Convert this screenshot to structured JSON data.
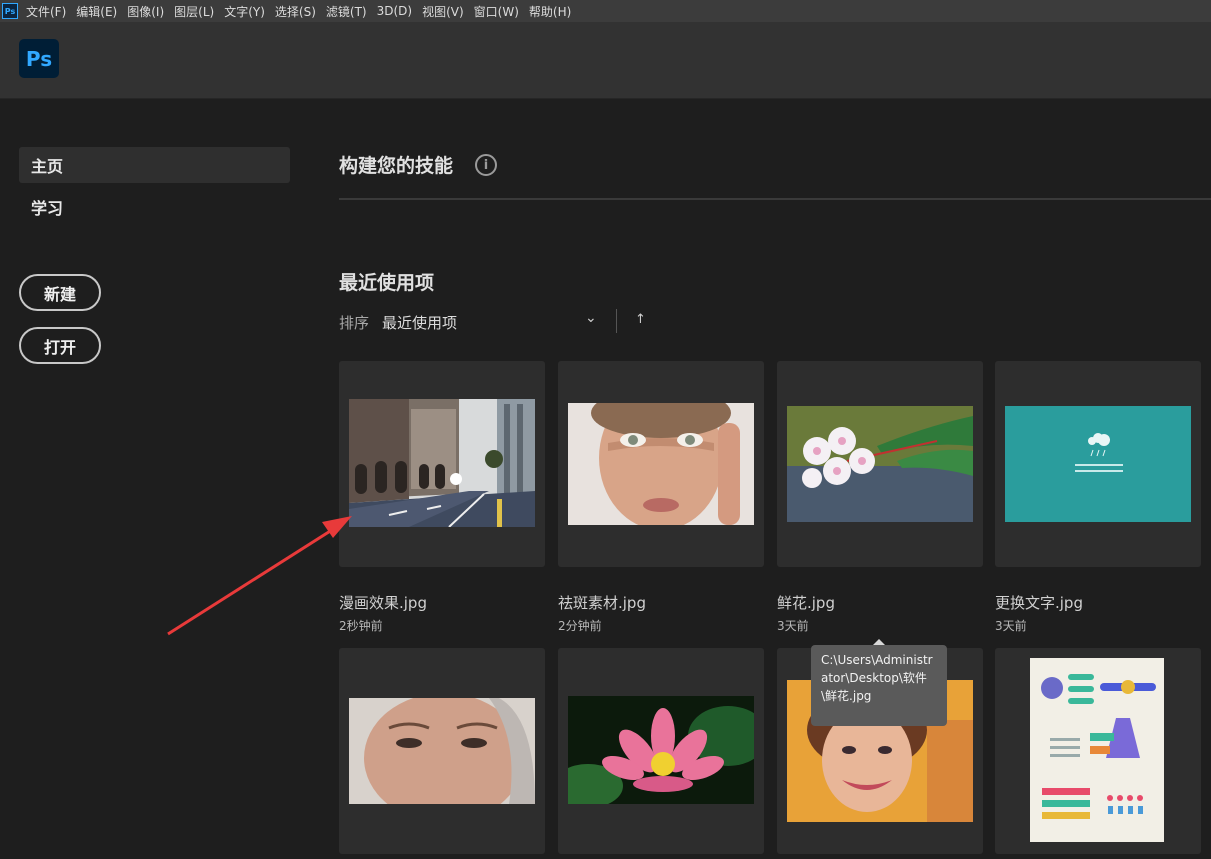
{
  "menubar": {
    "items": [
      "文件(F)",
      "编辑(E)",
      "图像(I)",
      "图层(L)",
      "文字(Y)",
      "选择(S)",
      "滤镜(T)",
      "3D(D)",
      "视图(V)",
      "窗口(W)",
      "帮助(H)"
    ]
  },
  "app": {
    "logo_text": "Ps",
    "accent": "#31a8ff"
  },
  "sidebar": {
    "items": [
      {
        "label": "主页",
        "active": true
      },
      {
        "label": "学习",
        "active": false
      }
    ],
    "new_button": "新建",
    "open_button": "打开"
  },
  "main": {
    "skills_title": "构建您的技能",
    "info_icon": "i",
    "recent_title": "最近使用项",
    "sort_label": "排序",
    "sort_value": "最近使用项",
    "sort_chevron": "⌄",
    "sort_direction_icon": "↑"
  },
  "files": [
    {
      "name": "漫画效果.jpg",
      "time": "2秒钟前"
    },
    {
      "name": "祛斑素材.jpg",
      "time": "2分钟前"
    },
    {
      "name": "鲜花.jpg",
      "time": "3天前"
    },
    {
      "name": "更换文字.jpg",
      "time": "3天前"
    }
  ],
  "tooltip": {
    "path": "C:\\Users\\Administrator\\Desktop\\软件\\鲜花.jpg"
  },
  "colors": {
    "background": "#1e1e1e",
    "card": "#2d2d2d",
    "annotation_arrow": "#e83a3a",
    "teal_slide": "#2a9d9d"
  }
}
